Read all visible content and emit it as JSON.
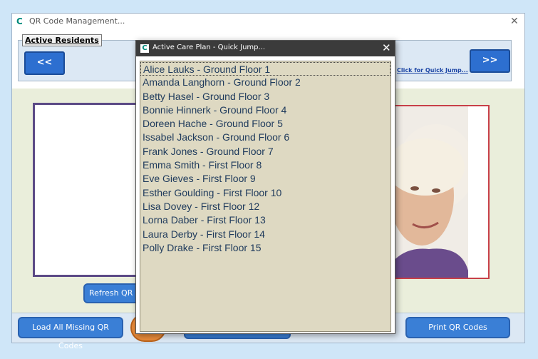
{
  "main_window": {
    "title": "QR Code Management...",
    "close_icon": "close-icon",
    "app_icon": "C"
  },
  "header": {
    "group_label": "Active Residents",
    "prev_label": "<<",
    "next_label": ">>",
    "quick_jump_link": "Click for Quick Jump..."
  },
  "actions": {
    "refresh_label": "Refresh QR C",
    "load_all_label": "Load All Missing QR Codes",
    "print_label": "Print QR Codes"
  },
  "modal": {
    "title": "Active Care Plan - Quick Jump...",
    "icon": "C",
    "close_label": "✕",
    "residents": [
      "Alice Lauks - Ground Floor 1",
      "Amanda Langhorn - Ground Floor 2",
      "Betty Hasel - Ground Floor 3",
      "Bonnie Hinnerk - Ground Floor 4",
      "Doreen Hache - Ground Floor 5",
      "Issabel Jackson - Ground Floor 6",
      "Frank Jones - Ground Floor 7",
      "Emma Smith - First Floor 8",
      "Eve Gieves - First Floor 9",
      "Esther Goulding - First Floor 10",
      "Lisa Dovey - First Floor 12",
      "Lorna Daber - First Floor 13",
      "Laura Derby - First Floor 14",
      "Polly Drake - First Floor 15"
    ],
    "selected_index": 0
  },
  "colors": {
    "accent_blue": "#3a7fd6",
    "modal_titlebar": "#3b3b3b",
    "list_bg": "#ded9c2",
    "photo_border": "#c84048",
    "qr_border": "#5c4a86"
  }
}
